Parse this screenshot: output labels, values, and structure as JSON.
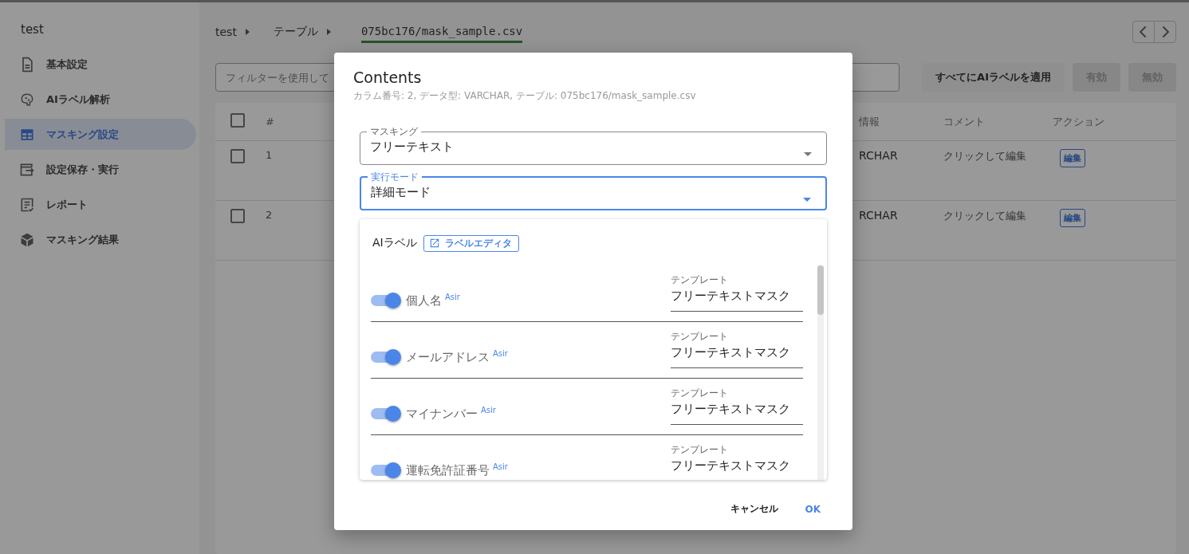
{
  "sidebar": {
    "title": "test",
    "items": [
      {
        "label": "基本設定",
        "selected": false
      },
      {
        "label": "AIラベル解析",
        "selected": false
      },
      {
        "label": "マスキング設定",
        "selected": true
      },
      {
        "label": "設定保存・実行",
        "selected": false
      },
      {
        "label": "レポート",
        "selected": false
      },
      {
        "label": "マスキング結果",
        "selected": false
      }
    ]
  },
  "breadcrumbs": [
    "test",
    "テーブル",
    "075bc176/mask_sample.csv"
  ],
  "toolbar": {
    "filter_placeholder": "フィルターを使用して",
    "buttons": [
      {
        "label": "すべてにAIラベルを適用",
        "disabled": false
      },
      {
        "label": "有効",
        "disabled": true
      },
      {
        "label": "無効",
        "disabled": true
      }
    ]
  },
  "table": {
    "all_checked": false,
    "columns": [
      "#",
      "情報",
      "コメント",
      "アクション"
    ],
    "rows": [
      {
        "checked": false,
        "number": "1",
        "type": "RCHAR",
        "comment": "クリックして編集",
        "action": "編集"
      },
      {
        "checked": false,
        "number": "2",
        "type": "RCHAR",
        "comment": "クリックして編集",
        "action": "編集"
      }
    ]
  },
  "dialog": {
    "title": "Contents",
    "subtitle": "カラム番号: 2, データ型: VARCHAR, テーブル: 075bc176/mask_sample.csv",
    "fields": [
      {
        "label": "マスキング",
        "value": "フリーテキスト",
        "focused": false
      },
      {
        "label": "実行モード",
        "value": "詳細モード",
        "focused": true
      }
    ],
    "ai_label": {
      "title": "AIラベル",
      "editor_button": "ラベルエディタ",
      "items": [
        {
          "name": "個人名",
          "on": true,
          "badge": "Asir",
          "template_label": "テンプレート",
          "template": "フリーテキストマスク"
        },
        {
          "name": "メールアドレス",
          "on": true,
          "badge": "Asir",
          "template_label": "テンプレート",
          "template": "フリーテキストマスク"
        },
        {
          "name": "マイナンバー",
          "on": true,
          "badge": "Asir",
          "template_label": "テンプレート",
          "template": "フリーテキストマスク"
        },
        {
          "name": "運転免許証番号",
          "on": true,
          "badge": "Asir",
          "template_label": "テンプレート",
          "template": "フリーテキストマスク"
        }
      ]
    },
    "actions": [
      {
        "label": "キャンセル",
        "kind": "text"
      },
      {
        "label": "OK",
        "kind": "primary"
      }
    ]
  }
}
